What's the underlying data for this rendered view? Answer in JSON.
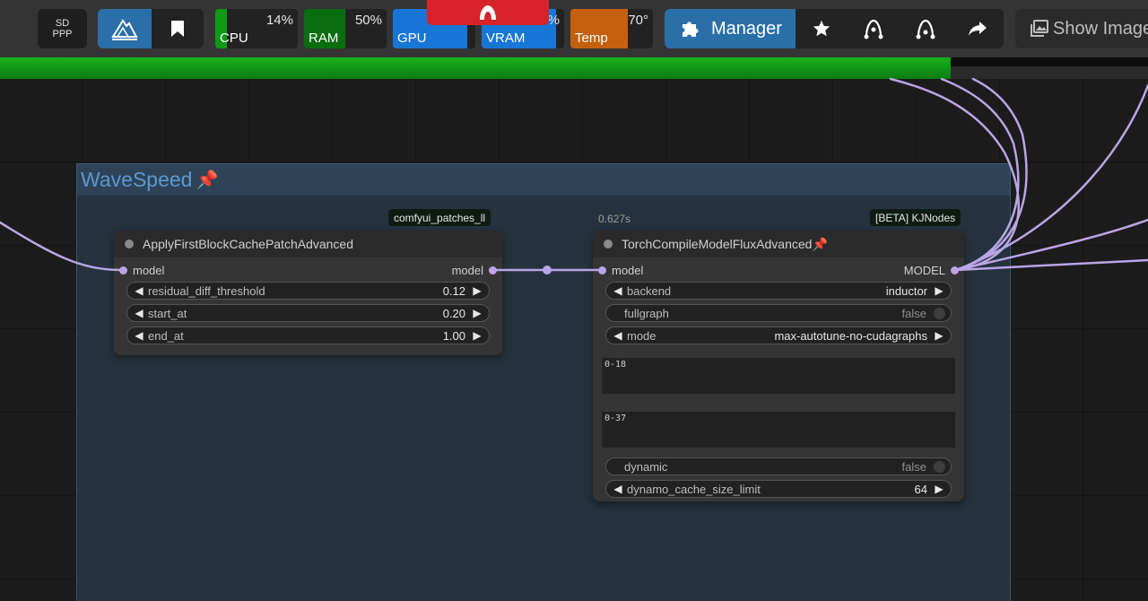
{
  "topbar": {
    "sdppp_line1": "SD",
    "sdppp_line2": "PPP",
    "meters": [
      {
        "label": "CPU",
        "value": "14%",
        "fill": 0.14,
        "color": "#0f9a16"
      },
      {
        "label": "RAM",
        "value": "50%",
        "fill": 0.5,
        "color": "#0a6d10"
      },
      {
        "label": "GPU",
        "value": "",
        "fill": 0.9,
        "color": "#1877d6"
      },
      {
        "label": "VRAM",
        "value": "%",
        "fill": 0.9,
        "color": "#1877d6"
      },
      {
        "label": "Temp",
        "value": "70°",
        "fill": 0.7,
        "color": "#c4600e"
      }
    ],
    "manager_label": "Manager",
    "show_image_label": "Show Image"
  },
  "progress": {
    "fraction": 0.828
  },
  "group": {
    "title": "WaveSpeed",
    "pin": "📌"
  },
  "node1": {
    "badge": "comfyui_patches_ll",
    "title": "ApplyFirstBlockCachePatchAdvanced",
    "input": "model",
    "output": "model",
    "widgets": [
      {
        "name": "residual_diff_threshold",
        "value": "0.12"
      },
      {
        "name": "start_at",
        "value": "0.20"
      },
      {
        "name": "end_at",
        "value": "1.00"
      }
    ]
  },
  "node2": {
    "timing": "0.627s",
    "badge": "[BETA] KJNodes",
    "title": "TorchCompileModelFluxAdvanced",
    "pin": "📌",
    "input": "model",
    "output": "MODEL",
    "backend": {
      "name": "backend",
      "value": "inductor"
    },
    "fullgraph": {
      "name": "fullgraph",
      "value": "false"
    },
    "mode": {
      "name": "mode",
      "value": "max-autotune-no-cudagraphs"
    },
    "textarea1": "0-18",
    "textarea2": "0-37",
    "dynamic": {
      "name": "dynamic",
      "value": "false"
    },
    "cache": {
      "name": "dynamo_cache_size_limit",
      "value": "64"
    }
  },
  "colors": {
    "accent": "#2a6fa8",
    "link": "#b9a6e6"
  }
}
